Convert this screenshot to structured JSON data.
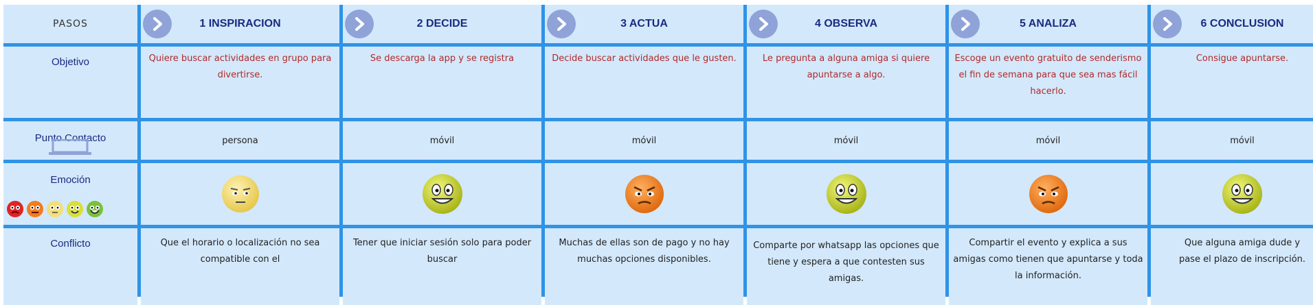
{
  "header": {
    "pasos": "PASOS",
    "steps": [
      "1 INSPIRACION",
      "2 DECIDE",
      "3 ACTUA",
      "4 OBSERVA",
      "5 ANALIZA",
      "6 CONCLUSION"
    ]
  },
  "rows": {
    "objetivo_label": "Objetivo",
    "punto_label": "Punto Contacto",
    "emocion_label": "Emoción",
    "conflicto_label": "Conflicto"
  },
  "objetivo": [
    "Quiere buscar actividades en grupo para divertirse.",
    "Se descarga la app y se registra",
    "Decide buscar actividades que le gusten.",
    "Le pregunta a alguna amiga si quiere apuntarse a algo.",
    "Escoge un evento gratuito de senderismo el fin de semana para que sea mas fácil hacerlo.",
    "Consigue apuntarse."
  ],
  "punto": [
    "persona",
    "móvil",
    "móvil",
    "móvil",
    "móvil",
    "móvil"
  ],
  "emocion": [
    "neutral-face-icon",
    "happy-face-icon",
    "annoyed-face-icon",
    "happy-face-icon",
    "annoyed-face-icon",
    "happy-face-icon"
  ],
  "conflicto": [
    "Que el horario o localización no sea compatible con el",
    "Tener que iniciar sesión solo para poder buscar",
    "Muchas de ellas son de pago y no hay muchas opciones disponibles.",
    "Comparte por whatsapp las opciones que tiene y espera a que contesten sus amigas.",
    "Compartir el evento y explica a sus amigas como tienen que apuntarse y toda la información.",
    "Que alguna amiga dude y pase el plazo de inscripción."
  ],
  "colors": {
    "grid": "#2f93e6",
    "cell": "#d3e8fb",
    "heading": "#1a2a80",
    "objective": "#b02a2a",
    "arrow": "#8fa3d8"
  }
}
